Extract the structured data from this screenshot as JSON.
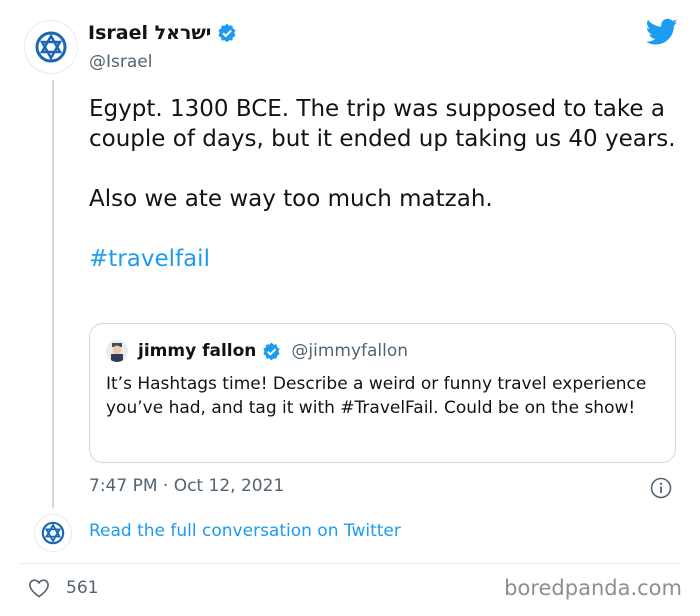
{
  "tweet": {
    "display_name": "Israel ישראל",
    "handle": "@Israel",
    "text_line_1": "Egypt. 1300 BCE. The trip was supposed to take a couple of days, but it ended up taking us 40 years.",
    "text_line_2": "Also we ate way too much matzah.",
    "hashtag": "#travelfail",
    "timestamp": "7:47 PM · Oct 12, 2021"
  },
  "quote": {
    "display_name": "jimmy fallon",
    "handle": "@jimmyfallon",
    "text": "It’s Hashtags time! Describe a weird or funny travel experience you’ve had, and tag it with #TravelFail. Could be on the show!"
  },
  "footer": {
    "read_link": "Read the full conversation on Twitter",
    "like_count": "561"
  },
  "watermark": "boredpanda.com",
  "colors": {
    "accent": "#1d9bf0",
    "text": "#0f1419",
    "muted": "#536471",
    "border": "#cfd9de"
  },
  "icons": {
    "avatar": "star-of-david-icon",
    "verified": "verified-badge-icon",
    "logo": "twitter-bird-icon",
    "info": "info-icon",
    "like": "heart-icon"
  }
}
